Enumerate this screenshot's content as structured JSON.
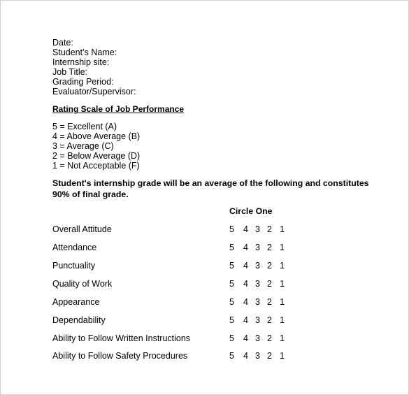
{
  "header_fields": [
    {
      "label": "Date:"
    },
    {
      "label": "Student’s Name:"
    },
    {
      "label": "Internship site:"
    },
    {
      "label": "Job Title:"
    },
    {
      "label": "Grading Period:"
    },
    {
      "label": "Evaluator/Supervisor:"
    }
  ],
  "rating_scale": {
    "title": "Rating Scale of Job Performance",
    "items": [
      "5 = Excellent (A)",
      "4 = Above Average (B)",
      "3 = Average (C)",
      "2 = Below Average (D)",
      "1 = Not Acceptable (F)"
    ]
  },
  "grade_note": "Student's internship grade will be an average of the following and constitutes 90% of final grade.",
  "circle_one_label": "Circle One",
  "criteria": [
    {
      "label": "Overall Attitude",
      "ratings": [
        "5",
        "4",
        "3",
        "2",
        "1"
      ]
    },
    {
      "label": "Attendance",
      "ratings": [
        "5",
        "4",
        "3",
        "2",
        "1"
      ]
    },
    {
      "label": "Punctuality",
      "ratings": [
        "5",
        "4",
        "3",
        "2",
        "1"
      ]
    },
    {
      "label": "Quality of Work",
      "ratings": [
        "5",
        "4",
        "3",
        "2",
        "1"
      ]
    },
    {
      "label": "Appearance",
      "ratings": [
        "5",
        "4",
        "3",
        "2",
        "1"
      ]
    },
    {
      "label": "Dependability",
      "ratings": [
        "5",
        "4",
        "3",
        "2",
        "1"
      ]
    },
    {
      "label": "Ability to Follow Written Instructions",
      "ratings": [
        "5",
        "4",
        "3",
        "2",
        "1"
      ]
    },
    {
      "label": "Ability to Follow Safety Procedures",
      "ratings": [
        "5",
        "4",
        "3",
        "2",
        "1"
      ]
    }
  ]
}
